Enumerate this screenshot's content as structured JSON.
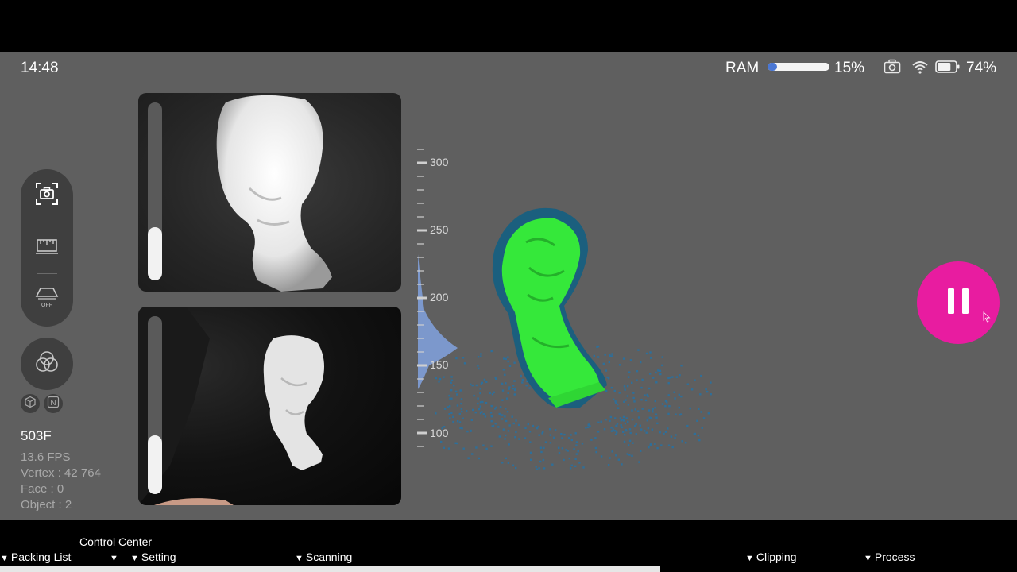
{
  "status_bar": {
    "time": "14:48",
    "ram_label": "RAM",
    "ram_percent": "15%",
    "ram_fraction": 0.15,
    "battery_percent": "74%",
    "battery_fraction": 0.74,
    "icons": [
      "screenshot-camera-icon",
      "wifi-icon",
      "battery-icon"
    ]
  },
  "left_panel": {
    "tools": [
      "scan-camera-icon",
      "ruler-measure-icon",
      "turntable-off-icon"
    ],
    "turntable_state": "OFF",
    "texture_icon": "color-circles-icon",
    "mini_icons": [
      "cube-icon",
      "n-mode-icon"
    ],
    "mini_label": "N"
  },
  "stats": {
    "frames": "503F",
    "fps": "13.6 FPS",
    "vertex": "Vertex : 42 764",
    "face": "Face : 0",
    "object": "Object : 2"
  },
  "cameras": {
    "top_exposure": 0.3,
    "bottom_exposure": 0.33
  },
  "distance_scale": {
    "ticks": [
      "300",
      "250",
      "200",
      "150",
      "100"
    ]
  },
  "controls": {
    "pause_icon": "pause-icon",
    "accent": "#e81ca0"
  },
  "taskbar": {
    "control_center": "Control Center",
    "items": [
      "Packing List",
      "Setting",
      "Scanning",
      "Clipping",
      "Process"
    ]
  }
}
